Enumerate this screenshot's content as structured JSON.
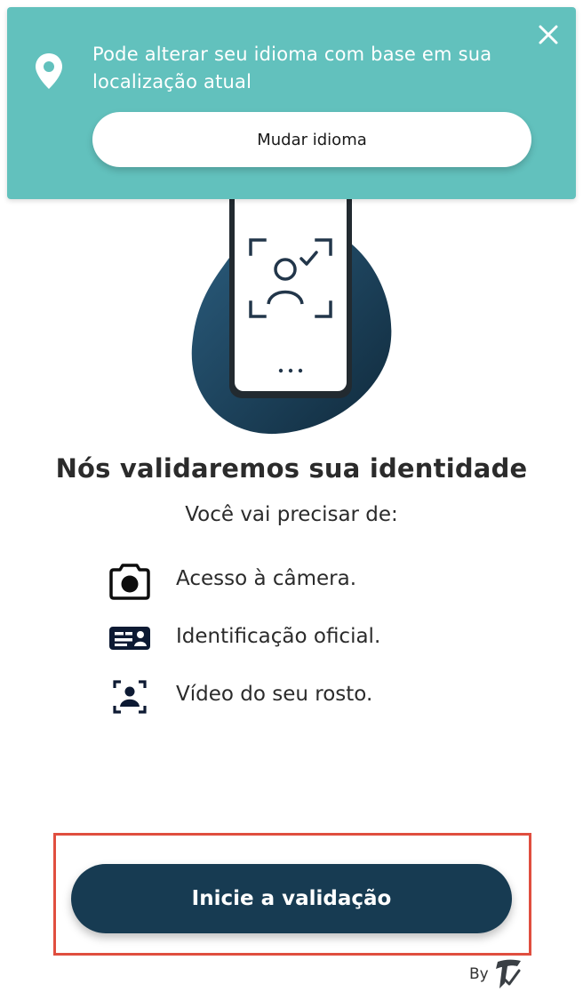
{
  "banner": {
    "message": "Pode alterar seu idioma com base em sua localização atual",
    "button_label": "Mudar idioma",
    "close_icon": "close-icon",
    "pin_icon": "location-pin-icon",
    "background_color": "#62c1bd"
  },
  "main": {
    "title": "Nós validaremos sua identidade",
    "subtitle": "Você vai precisar de:",
    "requirements": [
      {
        "icon": "camera-icon",
        "label": "Acesso à câmera."
      },
      {
        "icon": "id-card-icon",
        "label": "Identificação oficial."
      },
      {
        "icon": "face-scan-icon",
        "label": "Vídeo do seu rosto."
      }
    ]
  },
  "cta": {
    "label": "Inicie a validação",
    "color": "#173b52"
  },
  "footer": {
    "by_label": "By",
    "logo_icon": "brand-logo-icon"
  },
  "colors": {
    "accent": "#62c1bd",
    "primary": "#173b52",
    "highlight": "#e04e3f"
  }
}
